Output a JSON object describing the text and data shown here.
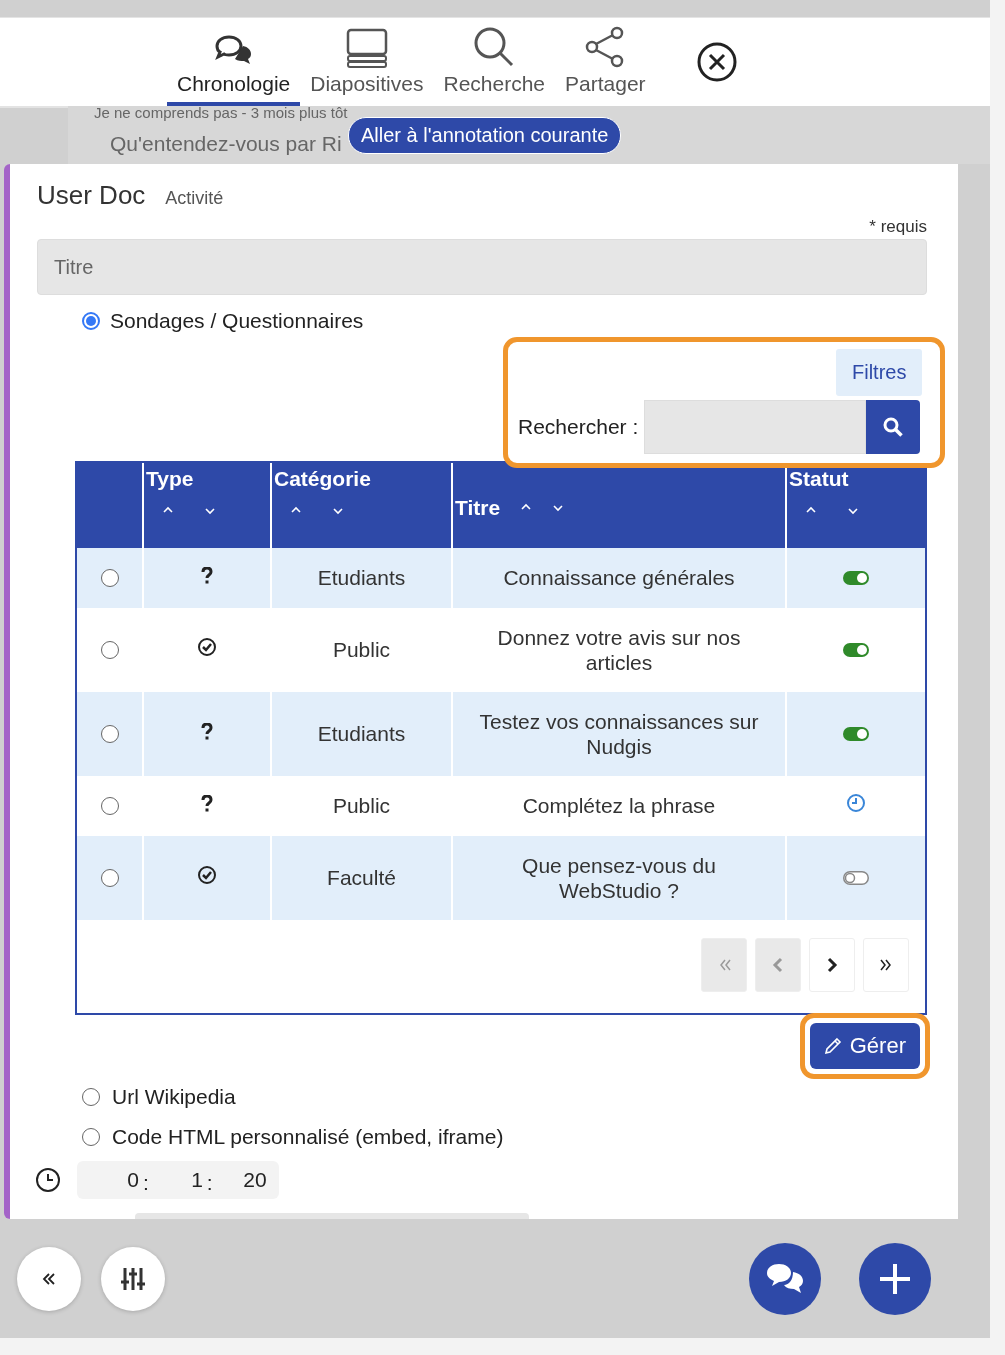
{
  "nav": {
    "tabs": [
      {
        "label": "Chronologie",
        "selected": true
      },
      {
        "label": "Diapositives",
        "selected": false
      },
      {
        "label": "Recherche",
        "selected": false
      },
      {
        "label": "Partager",
        "selected": false
      }
    ]
  },
  "background_comment": {
    "meta": "Je ne comprends pas - 3 mois plus tôt",
    "text": "Qu'entendez-vous par Ri"
  },
  "current_annotation_button": "Aller à l'annotation courante",
  "card": {
    "title": "User Doc",
    "subtitle": "Activité",
    "required_note": "* requis",
    "title_field": {
      "placeholder": "Titre"
    },
    "sources": [
      {
        "label": "Sondages / Questionnaires",
        "selected": true
      },
      {
        "label": "Url Wikipedia",
        "selected": false
      },
      {
        "label": "Code HTML personnalisé (embed, iframe)",
        "selected": false
      }
    ],
    "filters_button": "Filtres",
    "search_label": "Rechercher :",
    "table": {
      "columns": [
        {
          "label": "Type",
          "kind": "stacked"
        },
        {
          "label": "Catégorie",
          "kind": "stacked"
        },
        {
          "label": "Titre",
          "kind": "inline"
        },
        {
          "label": "Statut",
          "kind": "stacked"
        }
      ],
      "rows": [
        {
          "selected": false,
          "type": {
            "kind": "question"
          },
          "category": "Etudiants",
          "title": "Connaissance générales",
          "status": {
            "kind": "on"
          }
        },
        {
          "selected": false,
          "type": {
            "kind": "check"
          },
          "category": "Public",
          "title": "Donnez votre avis sur nos articles",
          "status": {
            "kind": "on"
          }
        },
        {
          "selected": false,
          "type": {
            "kind": "question"
          },
          "category": "Etudiants",
          "title": "Testez vos connaissances sur Nudgis",
          "status": {
            "kind": "on"
          }
        },
        {
          "selected": false,
          "type": {
            "kind": "question"
          },
          "category": "Public",
          "title": "Complétez la phrase",
          "status": {
            "kind": "scheduled"
          }
        },
        {
          "selected": false,
          "type": {
            "kind": "check"
          },
          "category": "Faculté",
          "title": "Que pensez-vous du WebStudio ?",
          "status": {
            "kind": "off"
          }
        }
      ],
      "pagination": [
        {
          "kind": "first",
          "disabled": true
        },
        {
          "kind": "prev",
          "disabled": true
        },
        {
          "kind": "next",
          "disabled": false
        },
        {
          "kind": "last",
          "disabled": false
        }
      ]
    },
    "manage_button": "Gérer",
    "time_fields": [
      "0",
      "1",
      "20"
    ],
    "time_separator": ":"
  }
}
